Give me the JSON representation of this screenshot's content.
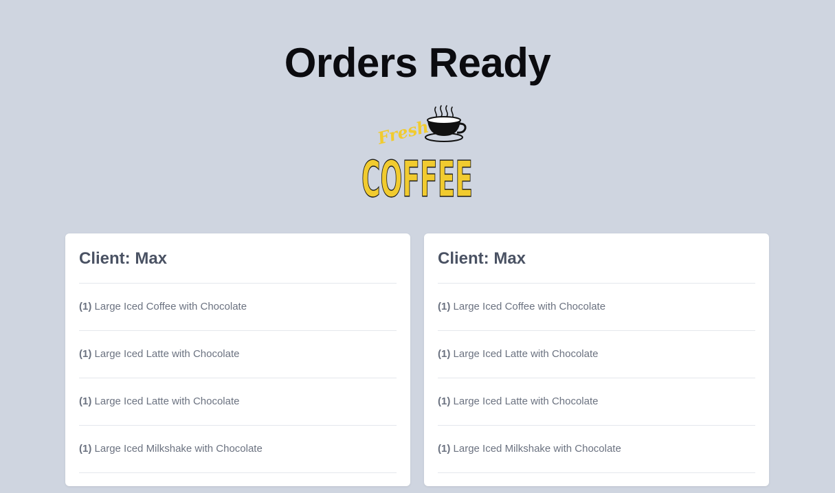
{
  "header": {
    "title": "Orders Ready"
  },
  "logo": {
    "script_word": "Fresh",
    "main_word": "COFFEE",
    "icon": "coffee-cup-icon",
    "accent_color": "#f1cb2f"
  },
  "orders": [
    {
      "client_label": "Client:",
      "client_name": "Max",
      "items": [
        {
          "qty": "(1)",
          "name": "Large Iced Coffee with Chocolate"
        },
        {
          "qty": "(1)",
          "name": "Large Iced Latte with Chocolate"
        },
        {
          "qty": "(1)",
          "name": "Large Iced Latte with Chocolate"
        },
        {
          "qty": "(1)",
          "name": "Large Iced Milkshake with Chocolate"
        }
      ]
    },
    {
      "client_label": "Client:",
      "client_name": "Max",
      "items": [
        {
          "qty": "(1)",
          "name": "Large Iced Coffee with Chocolate"
        },
        {
          "qty": "(1)",
          "name": "Large Iced Latte with Chocolate"
        },
        {
          "qty": "(1)",
          "name": "Large Iced Latte with Chocolate"
        },
        {
          "qty": "(1)",
          "name": "Large Iced Milkshake with Chocolate"
        }
      ]
    }
  ]
}
